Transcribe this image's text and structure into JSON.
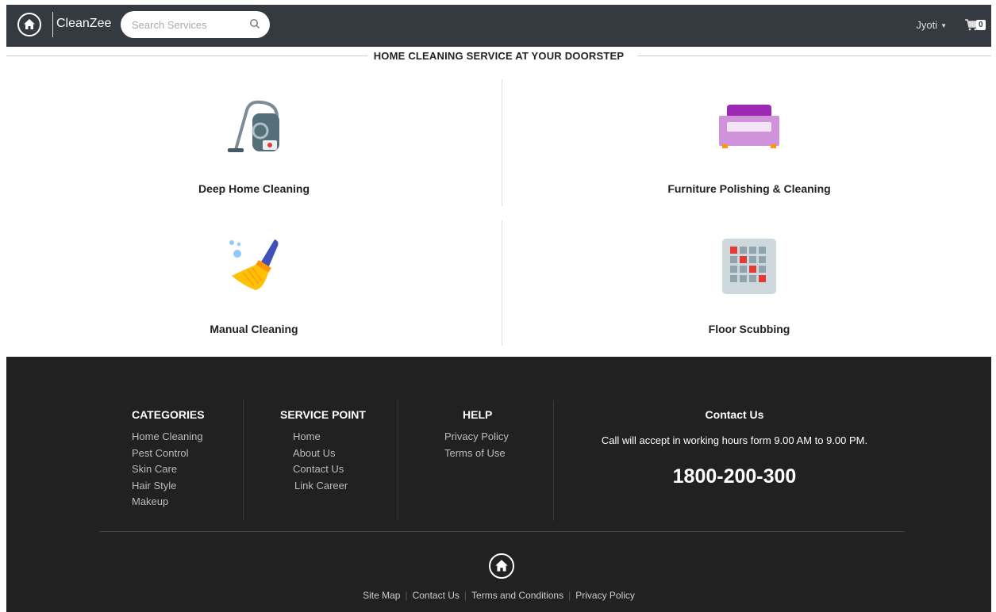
{
  "header": {
    "brand": "CleanZee",
    "search_placeholder": "Search Services",
    "user_name": "Jyoti",
    "cart_count": "0"
  },
  "heading": "HOME CLEANING SERVICE AT YOUR DOORSTEP",
  "services": [
    {
      "label": "Deep Home Cleaning",
      "icon": "vacuum-cleaner-icon"
    },
    {
      "label": "Furniture Polishing & Cleaning",
      "icon": "sofa-icon"
    },
    {
      "label": "Manual Cleaning",
      "icon": "broom-icon"
    },
    {
      "label": "Floor Scubbing",
      "icon": "floor-tiles-icon"
    }
  ],
  "footer": {
    "categories": {
      "title": "CATEGORIES",
      "items": [
        "Home Cleaning",
        "Pest Control",
        "Skin Care",
        "Hair Style",
        "Makeup"
      ]
    },
    "service_point": {
      "title": "SERVICE POINT",
      "items": [
        "Home",
        "About Us",
        "Contact Us",
        "Link Career"
      ]
    },
    "help": {
      "title": "HELP",
      "items": [
        "Privacy Policy",
        "Terms of Use"
      ]
    },
    "contact": {
      "title": "Contact Us",
      "description": "Call will accept in working hours form 9.00 AM to 9.00 PM.",
      "phone": "1800-200-300"
    },
    "bottom_links": [
      "Site Map",
      "Contact Us",
      "Terms and Conditions",
      "Privacy Policy"
    ]
  },
  "colors": {
    "header_bg": "#343a40",
    "footer_bg": "#212121",
    "sofa_purple": "#9c27b0",
    "broom_blue": "#3f51b5",
    "broom_yellow": "#ffc107",
    "tile_red": "#e53935"
  }
}
